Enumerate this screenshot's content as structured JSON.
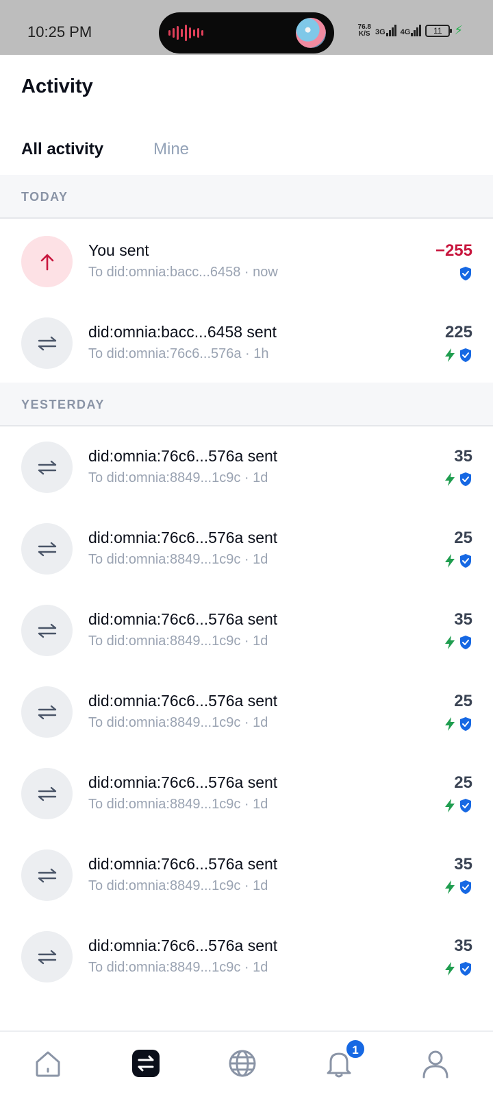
{
  "status_bar": {
    "time": "10:25 PM",
    "net_speed_value": "76.8",
    "net_speed_unit": "K/S",
    "signal_1": "3G",
    "signal_2": "4G",
    "battery": "11"
  },
  "header": {
    "title": "Activity"
  },
  "tabs": [
    {
      "label": "All activity",
      "active": true
    },
    {
      "label": "Mine",
      "active": false
    }
  ],
  "sections": [
    {
      "label": "TODAY"
    },
    {
      "label": "YESTERDAY"
    }
  ],
  "transactions": [
    {
      "title": "You sent",
      "subtitle": "To did:omnia:bacc...6458 · now",
      "amount": "−255",
      "direction": "sent",
      "fast": false,
      "verified": true
    },
    {
      "title": "did:omnia:bacc...6458 sent",
      "subtitle": "To did:omnia:76c6...576a · 1h",
      "amount": "225",
      "direction": "transfer",
      "fast": true,
      "verified": true
    },
    {
      "title": "did:omnia:76c6...576a sent",
      "subtitle": "To did:omnia:8849...1c9c · 1d",
      "amount": "35",
      "direction": "transfer",
      "fast": true,
      "verified": true
    },
    {
      "title": "did:omnia:76c6...576a sent",
      "subtitle": "To did:omnia:8849...1c9c · 1d",
      "amount": "25",
      "direction": "transfer",
      "fast": true,
      "verified": true
    },
    {
      "title": "did:omnia:76c6...576a sent",
      "subtitle": "To did:omnia:8849...1c9c · 1d",
      "amount": "35",
      "direction": "transfer",
      "fast": true,
      "verified": true
    },
    {
      "title": "did:omnia:76c6...576a sent",
      "subtitle": "To did:omnia:8849...1c9c · 1d",
      "amount": "25",
      "direction": "transfer",
      "fast": true,
      "verified": true
    },
    {
      "title": "did:omnia:76c6...576a sent",
      "subtitle": "To did:omnia:8849...1c9c · 1d",
      "amount": "25",
      "direction": "transfer",
      "fast": true,
      "verified": true
    },
    {
      "title": "did:omnia:76c6...576a sent",
      "subtitle": "To did:omnia:8849...1c9c · 1d",
      "amount": "35",
      "direction": "transfer",
      "fast": true,
      "verified": true
    },
    {
      "title": "did:omnia:76c6...576a sent",
      "subtitle": "To did:omnia:8849...1c9c · 1d",
      "amount": "35",
      "direction": "transfer",
      "fast": true,
      "verified": true
    }
  ],
  "bottom_nav": {
    "items": [
      {
        "icon": "home-icon",
        "active": false
      },
      {
        "icon": "activity-icon",
        "active": true
      },
      {
        "icon": "globe-icon",
        "active": false
      },
      {
        "icon": "bell-icon",
        "active": false
      },
      {
        "icon": "profile-icon",
        "active": false
      }
    ],
    "notification_count": "1"
  },
  "colors": {
    "accent": "#1668e3",
    "negative": "#c8163e",
    "fast": "#1f9d4f",
    "verified": "#1668e3"
  }
}
